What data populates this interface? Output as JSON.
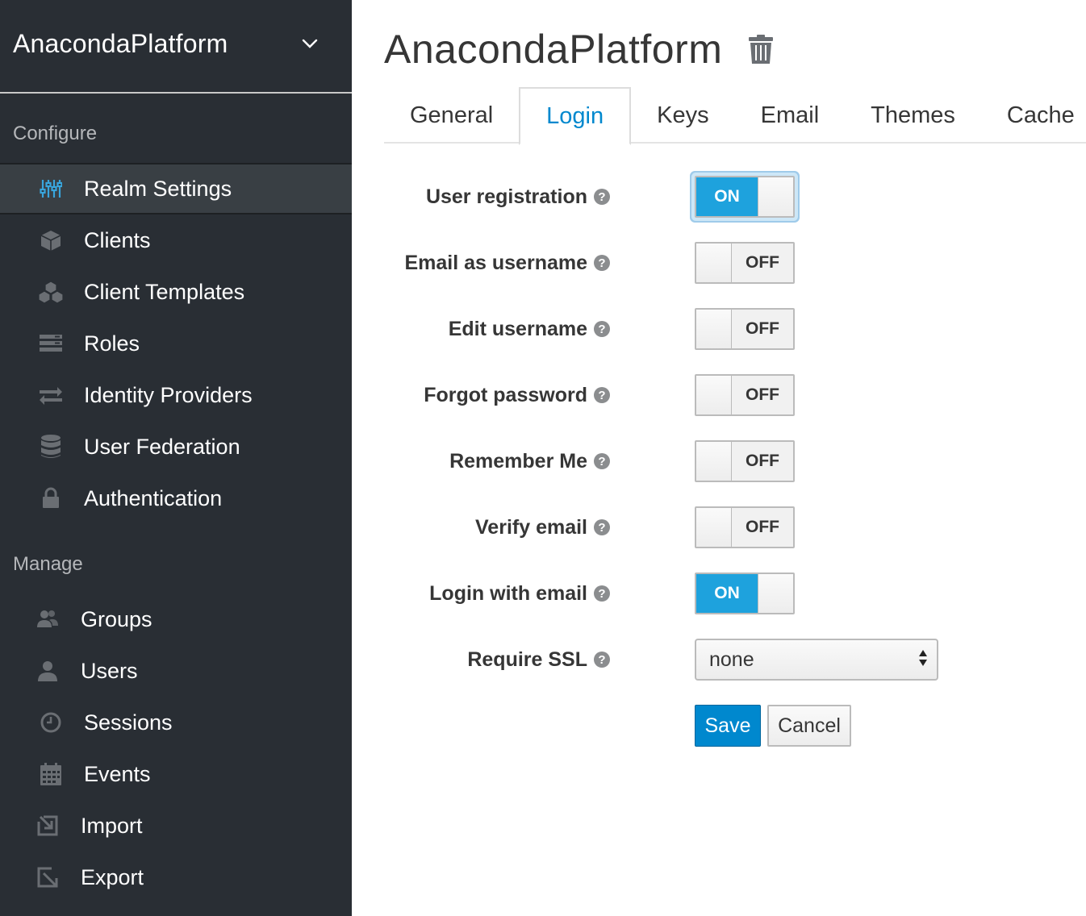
{
  "realm_selector": {
    "name": "AnacondaPlatform",
    "icon": "chevron-down-icon"
  },
  "sidebar": {
    "configure_title": "Configure",
    "configure_items": [
      {
        "label": "Realm Settings",
        "icon": "sliders-icon",
        "active": true
      },
      {
        "label": "Clients",
        "icon": "cube-icon"
      },
      {
        "label": "Client Templates",
        "icon": "cubes-icon"
      },
      {
        "label": "Roles",
        "icon": "list-icon"
      },
      {
        "label": "Identity Providers",
        "icon": "exchange-icon"
      },
      {
        "label": "User Federation",
        "icon": "database-icon"
      },
      {
        "label": "Authentication",
        "icon": "lock-icon"
      }
    ],
    "manage_title": "Manage",
    "manage_items": [
      {
        "label": "Groups",
        "icon": "users-icon"
      },
      {
        "label": "Users",
        "icon": "user-icon"
      },
      {
        "label": "Sessions",
        "icon": "clock-icon"
      },
      {
        "label": "Events",
        "icon": "calendar-icon"
      },
      {
        "label": "Import",
        "icon": "import-icon"
      },
      {
        "label": "Export",
        "icon": "export-icon"
      }
    ]
  },
  "header": {
    "title": "AnacondaPlatform",
    "delete_icon": "trash-icon"
  },
  "tabs": [
    {
      "label": "General"
    },
    {
      "label": "Login",
      "active": true
    },
    {
      "label": "Keys"
    },
    {
      "label": "Email"
    },
    {
      "label": "Themes"
    },
    {
      "label": "Cache"
    }
  ],
  "form": {
    "help_glyph": "?",
    "fields": [
      {
        "label": "User registration",
        "state": "ON"
      },
      {
        "label": "Email as username",
        "state": "OFF"
      },
      {
        "label": "Edit username",
        "state": "OFF"
      },
      {
        "label": "Forgot password",
        "state": "OFF"
      },
      {
        "label": "Remember Me",
        "state": "OFF"
      },
      {
        "label": "Verify email",
        "state": "OFF"
      },
      {
        "label": "Login with email",
        "state": "ON"
      }
    ],
    "require_ssl": {
      "label": "Require SSL",
      "value": "none"
    },
    "save_label": "Save",
    "cancel_label": "Cancel"
  },
  "colors": {
    "accent": "#0088ce",
    "toggle_on": "#1ea2dd",
    "sidebar_bg": "#292e34"
  }
}
